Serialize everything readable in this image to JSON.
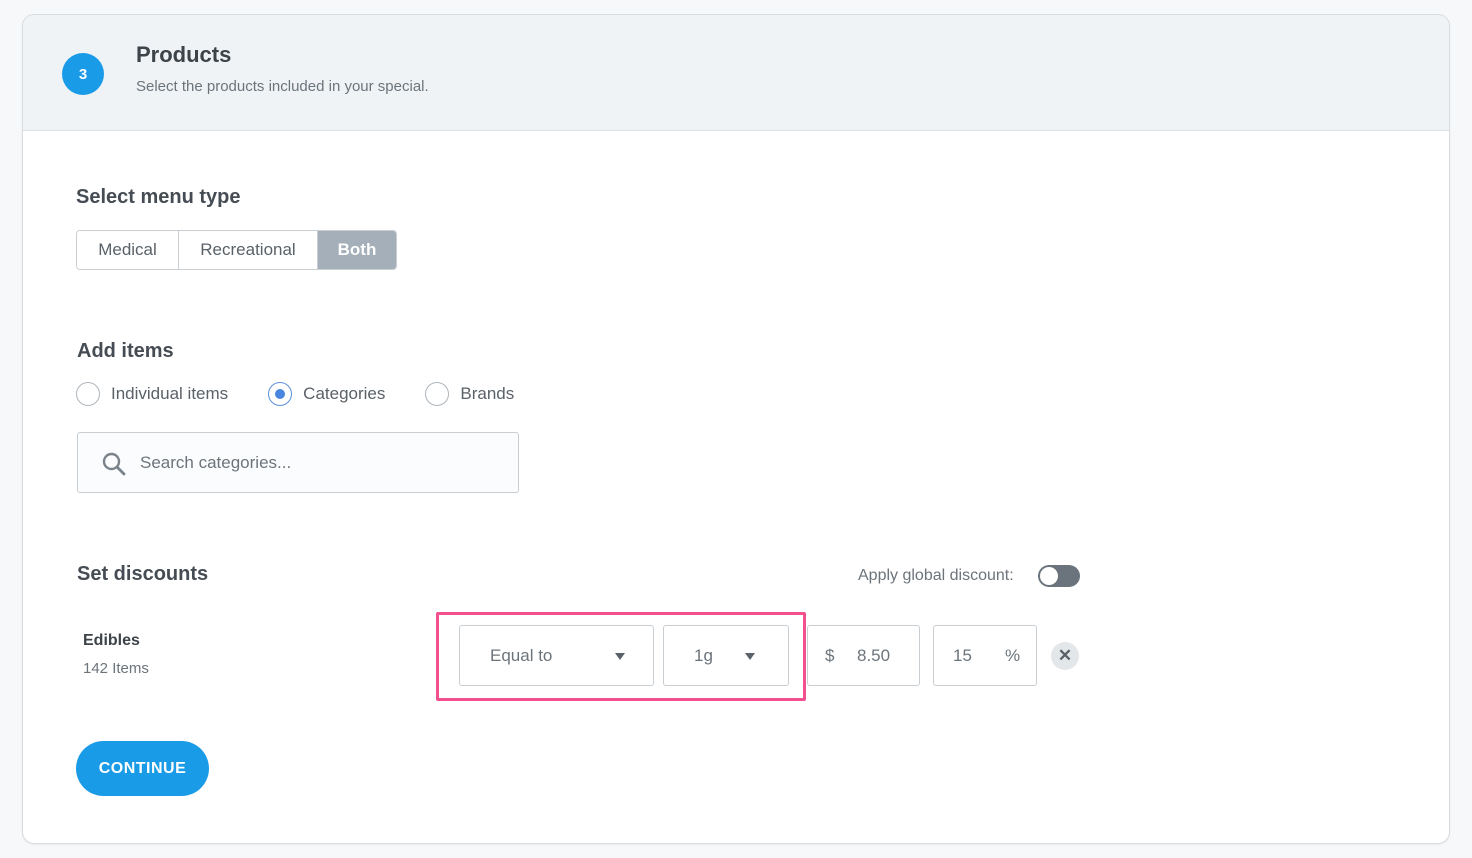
{
  "header": {
    "step": "3",
    "title": "Products",
    "subtitle": "Select the products included in your special."
  },
  "menu_type": {
    "title": "Select menu type",
    "options": [
      "Medical",
      "Recreational",
      "Both"
    ],
    "selected": "Both"
  },
  "add_items": {
    "title": "Add items",
    "options": [
      "Individual items",
      "Categories",
      "Brands"
    ],
    "selected": "Categories",
    "search_placeholder": "Search categories...",
    "search_icon": "search-icon"
  },
  "discounts": {
    "title": "Set discounts",
    "global_label": "Apply global discount:",
    "global_enabled": false,
    "rows": [
      {
        "category": "Edibles",
        "count": "142 Items",
        "condition": "Equal to",
        "weight": "1g",
        "currency": "$",
        "price": "8.50",
        "percent": "15",
        "percent_symbol": "%",
        "remove_label": "✕"
      }
    ]
  },
  "colors": {
    "accent": "#1a9be8",
    "highlight": "#f2508e",
    "segment_active": "#a4afb9"
  },
  "continue_label": "CONTINUE"
}
